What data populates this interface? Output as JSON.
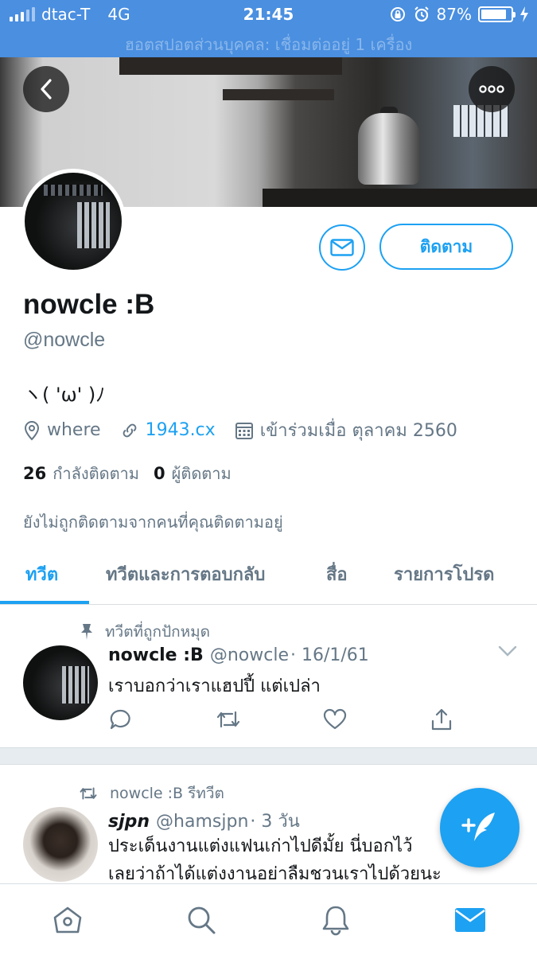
{
  "status_bar": {
    "carrier": "dtac-T",
    "network": "4G",
    "time": "21:45",
    "battery_percent": "87%",
    "battery_level": 0.87,
    "hotspot_text": "ฮอตสปอตส่วนบุคคล: เชื่อมต่ออยู่ 1 เครื่อง"
  },
  "header": {
    "back_icon": "back-arrow-icon",
    "more_icon": "more-dots-icon"
  },
  "profile": {
    "display_name": "nowcle :B",
    "handle": "@nowcle",
    "bio": "ヽ( 'ω' )ﾉ",
    "location": "where",
    "website": "1943.cx",
    "joined": "เข้าร่วมเมื่อ ตุลาคม 2560",
    "following_count": "26",
    "following_label": "กำลังติดตาม",
    "followers_count": "0",
    "followers_label": "ผู้ติดตาม",
    "followed_by_note": "ยังไม่ถูกติดตามจากคนที่คุณติดตามอยู่",
    "follow_button": "ติดตาม",
    "message_icon": "envelope-icon"
  },
  "tabs": [
    {
      "label": "ทวีต",
      "active": true
    },
    {
      "label": "ทวีตและการตอบกลับ",
      "active": false
    },
    {
      "label": "สื่อ",
      "active": false
    },
    {
      "label": "รายการโปรด",
      "active": false
    }
  ],
  "tweets": [
    {
      "context": "ทวีตที่ถูกปักหมุด",
      "context_icon": "pin-icon",
      "name": "nowcle :B",
      "handle": "@nowcle",
      "date": "· 16/1/61",
      "text": "เราบอกว่าเราแฮปปี้ แต่เปล่า"
    },
    {
      "context": "nowcle :B รีทวีต",
      "context_icon": "retweet-icon",
      "name": "sjpn",
      "handle": "@hamsjpn",
      "date": "· 3 วัน",
      "text_line1": "ประเด็นงานแต่งแฟนเก่าไปดีมั้ย นี่บอกไว้",
      "text_line2": "เลยว่าถ้าได้แต่งงานอย่าลืมชวนเราไปด้วยนะ"
    }
  ],
  "bottom_nav": [
    "home-icon",
    "search-icon",
    "notifications-icon",
    "messages-icon"
  ],
  "colors": {
    "accent": "#1da1f2",
    "status_bar": "#4a8fe0",
    "secondary_text": "#657786"
  }
}
